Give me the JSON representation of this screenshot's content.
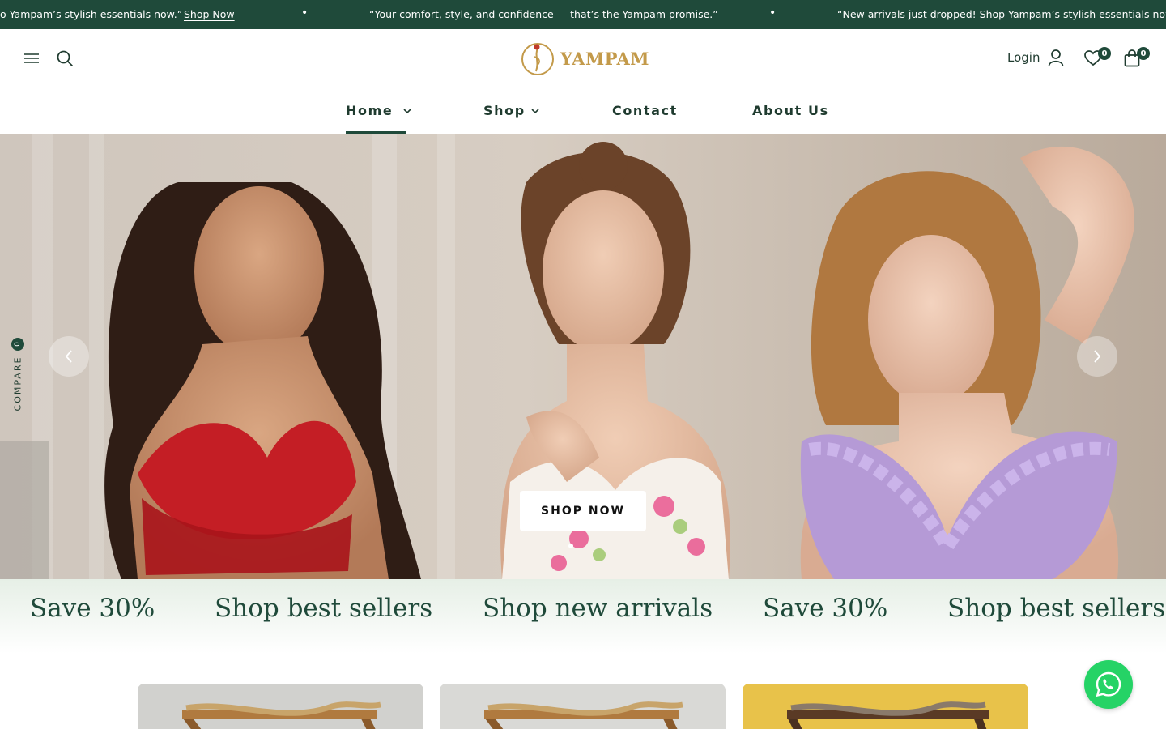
{
  "announcement": {
    "messages": [
      "o Yampam’s stylish essentials now.”",
      "“Your comfort, style, and confidence — that’s the Yampam promise.”",
      "“New arrivals just dropped! Shop Yampam’s stylish essentials now"
    ],
    "shop_now_label": "Shop Now",
    "separator": "•"
  },
  "header": {
    "logo_text": "YAMPAM",
    "login_label": "Login",
    "wishlist_count": "0",
    "cart_count": "0",
    "icons": [
      "menu-icon",
      "search-icon",
      "user-icon",
      "heart-icon",
      "bag-icon"
    ]
  },
  "nav": {
    "items": [
      {
        "label": "Home",
        "has_dropdown": true,
        "active": true
      },
      {
        "label": "Shop",
        "has_dropdown": true
      },
      {
        "label": "Contact"
      },
      {
        "label": "About Us"
      }
    ]
  },
  "hero": {
    "button_label": "SHOP NOW",
    "slide_count": 1,
    "active_slide": 1
  },
  "compare": {
    "label": "COMPARE",
    "count": "0"
  },
  "promo": {
    "items": [
      "Save 30%",
      "Shop best sellers",
      "Shop new arrivals",
      "Save 30%",
      "Shop best sellers"
    ]
  },
  "colors": {
    "brand_green": "#1f4a3a",
    "logo_gold": "#c39a4a",
    "whatsapp": "#25d366"
  }
}
